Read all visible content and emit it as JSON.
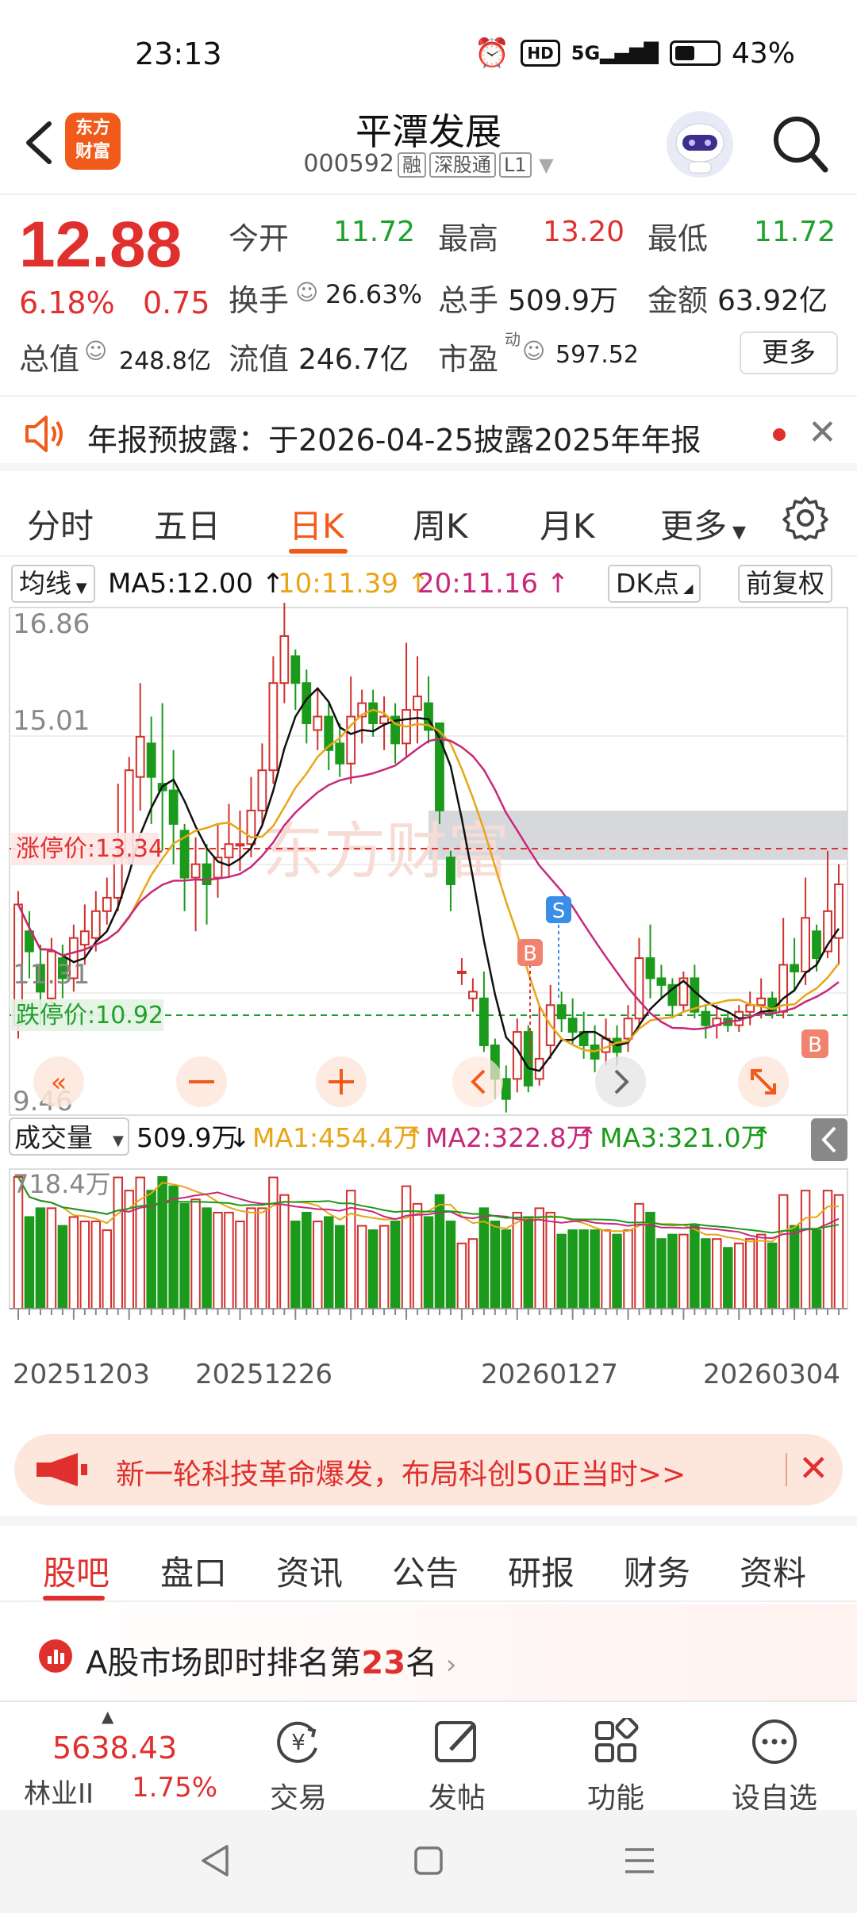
{
  "status": {
    "time": "23:13",
    "battery": "43%",
    "net": "5G",
    "hd": "HD"
  },
  "header": {
    "logo": "东方\n财富",
    "title": "平潭发展",
    "code": "000592",
    "tags": [
      "融",
      "深股通",
      "L1"
    ]
  },
  "quote": {
    "price": "12.88",
    "pct": "6.18%",
    "change": "0.75",
    "open_label": "今开",
    "open": "11.72",
    "high_label": "最高",
    "high": "13.20",
    "low_label": "最低",
    "low": "11.72",
    "turnover_label": "换手",
    "turnover": "26.63%",
    "volume_label": "总手",
    "volume": "509.9万",
    "amount_label": "金额",
    "amount": "63.92亿",
    "mktcap_label": "总值",
    "mktcap": "248.8亿",
    "float_label": "流值",
    "float": "246.7亿",
    "pe_label": "市盈",
    "pe_sup": "动",
    "pe": "597.52",
    "more": "更多"
  },
  "notice": {
    "text": "年报预披露：于2026-04-25披露2025年年报"
  },
  "ktabs": [
    "分时",
    "五日",
    "日K",
    "周K",
    "月K",
    "更多"
  ],
  "indicators": {
    "ma_select": "均线",
    "ma5": "MA5:12.00",
    "ma10": "10:11.39",
    "ma20": "20:11.16",
    "dk": "DK点",
    "fq": "前复权",
    "colors": {
      "ma5": "#111111",
      "ma10": "#e8a517",
      "ma20": "#c8287a",
      "up": "#d0312d",
      "down": "#1b9a1b"
    }
  },
  "chart_data": {
    "type": "candlestick",
    "y_ticks": [
      "16.86",
      "15.01",
      "11.31",
      "9.46"
    ],
    "limit_up_label": "涨停价:13.34",
    "limit_up": 13.34,
    "limit_down_label": "跌停价:10.92",
    "limit_down": 10.92,
    "watermark": "东方财富",
    "markers": [
      "B",
      "S",
      "B"
    ],
    "candles": [
      [
        10.8,
        12.6,
        12.8,
        10.6
      ],
      [
        12.2,
        11.9,
        12.5,
        11.5
      ],
      [
        11.7,
        11.3,
        12.0,
        10.8
      ],
      [
        11.2,
        11.9,
        12.1,
        10.9
      ],
      [
        11.8,
        11.5,
        12.0,
        11.2
      ],
      [
        11.5,
        12.1,
        12.3,
        11.3
      ],
      [
        12.0,
        12.2,
        12.6,
        11.7
      ],
      [
        12.1,
        12.5,
        12.8,
        11.9
      ],
      [
        12.5,
        12.7,
        13.0,
        12.3
      ],
      [
        12.7,
        13.3,
        14.4,
        12.5
      ],
      [
        13.3,
        14.6,
        14.8,
        13.2
      ],
      [
        14.5,
        15.1,
        15.9,
        14.0
      ],
      [
        15.0,
        14.5,
        15.4,
        13.8
      ],
      [
        14.4,
        14.3,
        15.6,
        13.4
      ],
      [
        14.3,
        13.8,
        14.9,
        13.2
      ],
      [
        13.7,
        13.0,
        13.8,
        12.5
      ],
      [
        13.0,
        13.2,
        13.6,
        12.2
      ],
      [
        13.2,
        12.9,
        13.5,
        12.3
      ],
      [
        13.0,
        13.3,
        13.8,
        12.7
      ],
      [
        13.3,
        13.5,
        14.1,
        13.0
      ],
      [
        13.5,
        13.5,
        14.0,
        13.1
      ],
      [
        13.5,
        14.0,
        14.5,
        13.3
      ],
      [
        14.0,
        14.6,
        15.0,
        13.8
      ],
      [
        14.6,
        15.9,
        16.3,
        14.4
      ],
      [
        15.9,
        16.6,
        17.1,
        15.6
      ],
      [
        16.3,
        15.9,
        16.4,
        15.5
      ],
      [
        15.9,
        15.3,
        16.1,
        15.0
      ],
      [
        15.2,
        15.4,
        15.8,
        14.9
      ],
      [
        15.4,
        14.9,
        15.6,
        14.6
      ],
      [
        15.0,
        14.7,
        15.3,
        14.5
      ],
      [
        14.7,
        15.4,
        16.0,
        14.4
      ],
      [
        15.4,
        15.6,
        15.8,
        15.0
      ],
      [
        15.6,
        15.3,
        15.8,
        15.1
      ],
      [
        15.3,
        15.4,
        15.7,
        14.9
      ],
      [
        15.4,
        15.0,
        15.6,
        14.7
      ],
      [
        15.0,
        15.5,
        16.5,
        14.8
      ],
      [
        15.5,
        15.7,
        16.3,
        15.0
      ],
      [
        15.6,
        15.2,
        16.0,
        15.0
      ],
      [
        15.3,
        14.0,
        15.3,
        13.8
      ],
      [
        13.3,
        12.9,
        13.4,
        12.5
      ],
      [
        11.6,
        11.6,
        11.8,
        11.4
      ],
      [
        11.2,
        11.3,
        11.5,
        11.0
      ],
      [
        11.2,
        10.5,
        11.6,
        10.4
      ],
      [
        10.5,
        10.0,
        10.6,
        9.7
      ],
      [
        10.0,
        9.7,
        10.2,
        9.5
      ],
      [
        10.0,
        10.7,
        10.9,
        9.8
      ],
      [
        10.7,
        9.9,
        10.8,
        9.8
      ],
      [
        10.0,
        10.3,
        11.1,
        9.9
      ],
      [
        10.5,
        11.1,
        11.4,
        10.3
      ],
      [
        11.1,
        10.9,
        11.3,
        10.7
      ],
      [
        10.9,
        10.7,
        11.2,
        10.5
      ],
      [
        10.7,
        10.5,
        11.0,
        10.3
      ],
      [
        10.5,
        10.3,
        10.8,
        10.1
      ],
      [
        10.4,
        10.6,
        10.9,
        10.2
      ],
      [
        10.6,
        10.4,
        10.8,
        10.2
      ],
      [
        10.6,
        10.9,
        11.1,
        10.4
      ],
      [
        10.9,
        11.8,
        12.1,
        10.8
      ],
      [
        11.8,
        11.5,
        12.3,
        11.2
      ],
      [
        11.5,
        11.4,
        11.7,
        11.2
      ],
      [
        11.4,
        11.1,
        11.5,
        10.9
      ],
      [
        11.1,
        11.5,
        11.6,
        11.0
      ],
      [
        11.5,
        11.0,
        11.7,
        10.9
      ],
      [
        11.0,
        10.8,
        11.1,
        10.6
      ],
      [
        10.8,
        10.9,
        11.1,
        10.6
      ],
      [
        10.9,
        10.8,
        11.0,
        10.7
      ],
      [
        10.8,
        11.0,
        11.1,
        10.7
      ],
      [
        11.0,
        11.1,
        11.3,
        10.8
      ],
      [
        11.1,
        11.2,
        11.5,
        10.9
      ],
      [
        11.2,
        11.0,
        11.3,
        10.9
      ],
      [
        11.0,
        11.7,
        12.4,
        10.9
      ],
      [
        11.7,
        11.6,
        12.1,
        11.3
      ],
      [
        11.6,
        12.4,
        13.0,
        11.4
      ],
      [
        12.2,
        11.8,
        12.3,
        11.6
      ],
      [
        11.9,
        12.5,
        13.4,
        11.8
      ],
      [
        12.1,
        12.9,
        13.2,
        11.7
      ]
    ],
    "volume": {
      "label": "成交量",
      "value": "509.9万",
      "ma1": "MA1:454.4万",
      "ma2": "MA2:322.8万",
      "ma3": "MA3:321.0万",
      "max_label": "718.4万",
      "max": 718.4
    },
    "x_ticks": [
      "20251203",
      "20251226",
      "20260127",
      "20260304"
    ]
  },
  "banner": {
    "text": "新一轮科技革命爆发，布局科创50正当时>>"
  },
  "btabs": [
    "股吧",
    "盘口",
    "资讯",
    "公告",
    "研报",
    "财务",
    "资料"
  ],
  "rank": {
    "prefix": "A股市场即时排名第",
    "num": "23",
    "suffix": "名"
  },
  "bnav": {
    "index": "5638.43",
    "sector": "林业II",
    "sector_pct": "1.75%",
    "items": [
      "交易",
      "发帖",
      "功能",
      "设自选"
    ]
  }
}
